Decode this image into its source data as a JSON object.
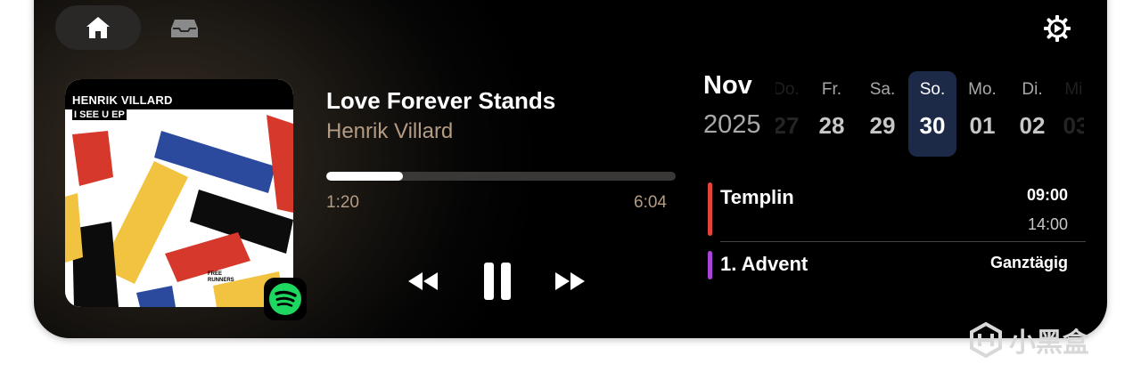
{
  "tabs": [
    {
      "name": "home",
      "icon": "home-icon",
      "active": true
    },
    {
      "name": "tray",
      "icon": "tray-icon",
      "active": false
    }
  ],
  "settings": {
    "icon": "gear-icon"
  },
  "album": {
    "artist_line": "HENRIK VILLARD",
    "ep_line": "I SEE U EP",
    "credit": "FREE RUNNERS",
    "source_icon": "spotify-icon",
    "colors": {
      "red": "#d6392b",
      "blue": "#2b4a9e",
      "yellow": "#f1c340",
      "black": "#0c0c0c"
    }
  },
  "track": {
    "title": "Love Forever Stands",
    "artist": "Henrik Villard",
    "elapsed": "1:20",
    "total": "6:04",
    "progress": 0.22
  },
  "controls": {
    "rewind_icon": "rewind-icon",
    "pause_icon": "pause-icon",
    "forward_icon": "fast-forward-icon"
  },
  "calendar": {
    "month": "Nov",
    "year": "2025",
    "days": [
      {
        "weekday": "Do.",
        "date": "27"
      },
      {
        "weekday": "Fr.",
        "date": "28"
      },
      {
        "weekday": "Sa.",
        "date": "29"
      },
      {
        "weekday": "So.",
        "date": "30",
        "selected": true
      },
      {
        "weekday": "Mo.",
        "date": "01"
      },
      {
        "weekday": "Di.",
        "date": "02"
      },
      {
        "weekday": "Mi.",
        "date": "03"
      }
    ],
    "selected_color": "#1d2a47"
  },
  "events": [
    {
      "title": "Templin",
      "start": "09:00",
      "end": "14:00",
      "color": "#e0443a"
    },
    {
      "title": "1. Advent",
      "start": "Ganztägig",
      "color": "#a844d8"
    }
  ],
  "watermark": {
    "text": "小黑盒",
    "icon": "heybox-logo-icon"
  }
}
